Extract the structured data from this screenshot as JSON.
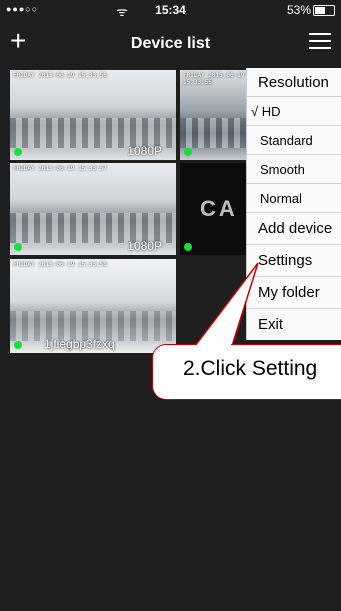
{
  "status_bar": {
    "signal": "●●●○○",
    "wifi": "ᯤ",
    "time": "15:34",
    "battery_text": "53%",
    "battery_level": 0.53
  },
  "nav": {
    "add_glyph": "+",
    "title": "Device list"
  },
  "tiles": [
    {
      "stamp": "FRIDAY 2015-06-19 15:33:56",
      "resolution": "1080P"
    },
    {
      "stamp": "FRIDAY 2015-06-19 15:33:56",
      "resolution": ""
    },
    {
      "stamp": "FRIDAY 2015-06-19 15:33:57",
      "resolution": "1080P"
    },
    {
      "logo": "CA"
    },
    {
      "stamp": "FRIDAY 2015-06-19 15:33:58",
      "name": "1jfiegbp3fzxq"
    }
  ],
  "menu": {
    "resolution_header": "Resolution",
    "hd": "√ HD",
    "standard": "Standard",
    "smooth": "Smooth",
    "normal": "Normal",
    "add_device": "Add device",
    "settings": "Settings",
    "my_folder": "My folder",
    "exit": "Exit"
  },
  "callout": {
    "text": "2.Click Setting"
  },
  "colors": {
    "online_dot": "#16e03a",
    "callout_border": "#cc0000"
  }
}
